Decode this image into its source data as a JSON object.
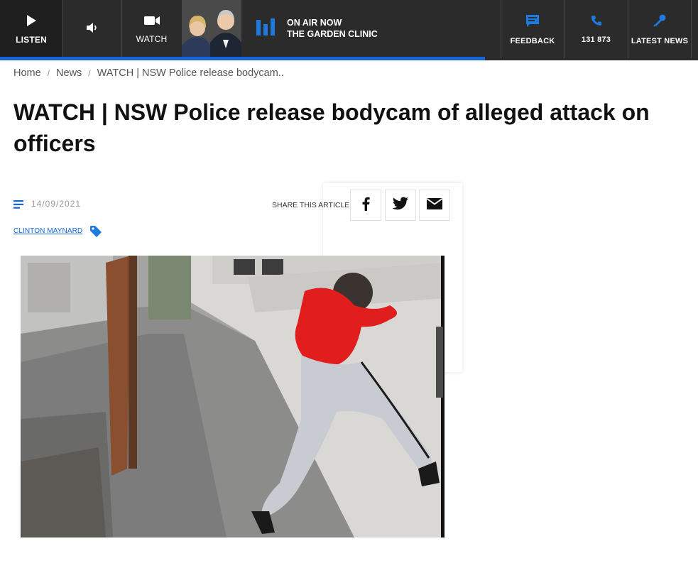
{
  "topbar": {
    "listen_label": "LISTEN",
    "watch_label": "WATCH",
    "on_air_line1": "ON AIR NOW",
    "on_air_line2": "THE GARDEN CLINIC",
    "feedback_label": "FEEDBACK",
    "phone_label": "131 873",
    "latest_news_label": "LATEST NEWS",
    "accent_color": "#1565d8"
  },
  "breadcrumb": {
    "home": "Home",
    "news": "News",
    "current": "WATCH | NSW Police release bodycam.."
  },
  "article": {
    "title": "WATCH | NSW Police release bodycam of alleged attack on officers",
    "date": "14/09/2021",
    "author": "CLINTON MAYNARD",
    "share_label": "SHARE THIS ARTICLE"
  },
  "icons": [
    "play-icon",
    "volume-icon",
    "video-camera-icon",
    "equalizer-icon",
    "chat-icon",
    "phone-icon",
    "microphone-icon",
    "text-lines-icon",
    "tag-icon",
    "facebook-icon",
    "twitter-icon",
    "email-icon"
  ]
}
